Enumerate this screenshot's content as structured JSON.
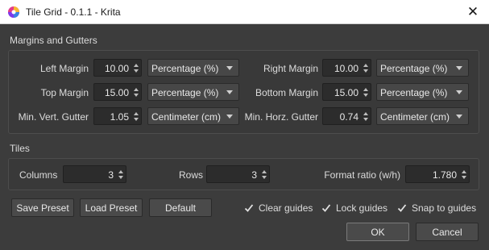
{
  "window": {
    "title": "Tile Grid - 0.1.1 - Krita",
    "close_glyph": "✕"
  },
  "margins_group": {
    "title": "Margins and Gutters",
    "left_margin": {
      "label": "Left Margin",
      "value": "10.00",
      "unit": "Percentage (%)"
    },
    "right_margin": {
      "label": "Right Margin",
      "value": "10.00",
      "unit": "Percentage (%)"
    },
    "top_margin": {
      "label": "Top Margin",
      "value": "15.00",
      "unit": "Percentage (%)"
    },
    "bottom_margin": {
      "label": "Bottom Margin",
      "value": "15.00",
      "unit": "Percentage (%)"
    },
    "min_vert_gutter": {
      "label": "Min. Vert. Gutter",
      "value": "1.05",
      "unit": "Centimeter (cm)"
    },
    "min_horz_gutter": {
      "label": "Min. Horz. Gutter",
      "value": "0.74",
      "unit": "Centimeter (cm)"
    }
  },
  "tiles_group": {
    "title": "Tiles",
    "columns": {
      "label": "Columns",
      "value": "3"
    },
    "rows": {
      "label": "Rows",
      "value": "3"
    },
    "format_ratio": {
      "label": "Format ratio (w/h)",
      "value": "1.780"
    }
  },
  "buttons": {
    "save_preset": "Save Preset",
    "load_preset": "Load Preset",
    "default": "Default",
    "ok": "OK",
    "cancel": "Cancel"
  },
  "checkboxes": {
    "clear_guides": {
      "label": "Clear guides",
      "checked": true
    },
    "lock_guides": {
      "label": "Lock guides",
      "checked": true
    },
    "snap_to_guides": {
      "label": "Snap to guides",
      "checked": true
    }
  },
  "colors": {
    "background": "#3c3c3c",
    "titlebar": "#ffffff",
    "field": "#2c2c2c"
  }
}
